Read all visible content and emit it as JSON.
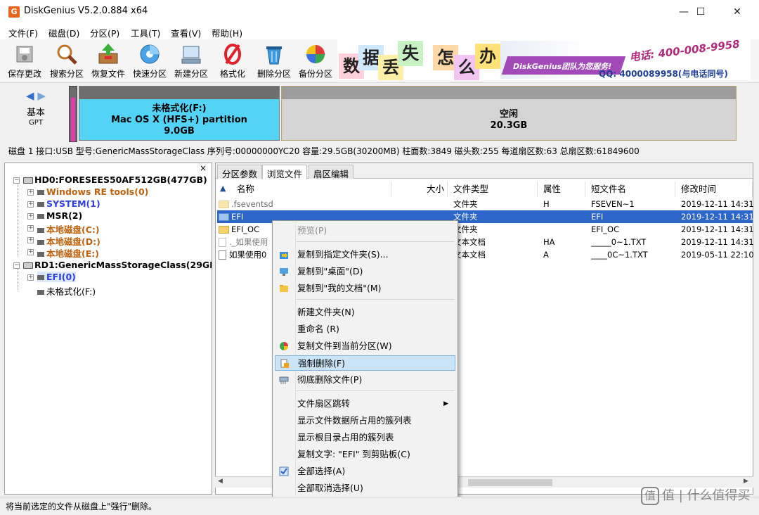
{
  "window": {
    "title": "DiskGenius V5.2.0.884 x64",
    "min_glyph": "—",
    "max_glyph": "☐",
    "close_glyph": "✕"
  },
  "menu": [
    "文件(F)",
    "磁盘(D)",
    "分区(P)",
    "工具(T)",
    "查看(V)",
    "帮助(H)"
  ],
  "toolbar": [
    {
      "label": "保存更改",
      "icon": "save-icon"
    },
    {
      "label": "搜索分区",
      "icon": "magnifier-icon"
    },
    {
      "label": "恢复文件",
      "icon": "recover-icon"
    },
    {
      "label": "快速分区",
      "icon": "quick-partition-icon"
    },
    {
      "label": "新建分区",
      "icon": "new-partition-icon"
    },
    {
      "label": "格式化",
      "icon": "format-icon"
    },
    {
      "label": "删除分区",
      "icon": "trash-icon"
    },
    {
      "label": "备份分区",
      "icon": "backup-icon"
    }
  ],
  "banner": {
    "tiles": [
      "数",
      "据",
      "丢",
      "失",
      "怎",
      "么",
      "办"
    ],
    "slogan": "DiskGenius团队为您服务!",
    "phone": "电话: 400-008-9958",
    "qq": "QQ: 4000089958(与电话同号)"
  },
  "diskmap": {
    "basic_label": "基本",
    "gpt_label": "GPT",
    "partition_f": {
      "name": "未格式化(F:)",
      "fs": "Mac OS X (HFS+) partition",
      "size": "9.0GB"
    },
    "free": {
      "name": "空闲",
      "size": "20.3GB"
    }
  },
  "disk_info": "磁盘 1 接口:USB  型号:GenericMassStorageClass  序列号:00000000YC20  容量:29.5GB(30200MB)  柱面数:3849  磁头数:255  每道扇区数:63  总扇区数:61849600",
  "tree": {
    "close_glyph": "×",
    "hd0": "HD0:FORESEES50AF512GB(477GB)",
    "hd0_children": [
      "Windows RE tools(0)",
      "SYSTEM(1)",
      "MSR(2)",
      "本地磁盘(C:)",
      "本地磁盘(D:)",
      "本地磁盘(E:)"
    ],
    "rd1": "RD1:GenericMassStorageClass(29GB",
    "rd1_children": [
      "EFI(0)",
      "未格式化(F:)"
    ]
  },
  "tabs": [
    "分区参数",
    "浏览文件",
    "扇区编辑"
  ],
  "columns": [
    "名称",
    "大小",
    "文件类型",
    "属性",
    "短文件名",
    "修改时间"
  ],
  "files": [
    {
      "name": ".fseventsd",
      "size": "",
      "type": "文件夹",
      "attr": "H",
      "short": "FSEVEN~1",
      "mtime": "2019-12-11 14:31"
    },
    {
      "name": "EFI",
      "size": "",
      "type": "文件夹",
      "attr": "",
      "short": "EFI",
      "mtime": "2019-12-11 14:31"
    },
    {
      "name": "EFI_OC",
      "size": "",
      "type": "文件夹",
      "attr": "",
      "short": "EFI_OC",
      "mtime": "2019-12-11 14:31"
    },
    {
      "name": "._如果使用",
      "size": "",
      "type": "文本文档",
      "attr": "HA",
      "short": "_____0~1.TXT",
      "mtime": "2019-12-11 14:31"
    },
    {
      "name": "如果使用0",
      "size": "",
      "type": "文本文档",
      "attr": "A",
      "short": "____0C~1.TXT",
      "mtime": "2019-05-11 22:10"
    }
  ],
  "context_menu": {
    "preview": "预览(P)",
    "copy_to_folder": "复制到指定文件夹(S)...",
    "copy_to_desktop": "复制到\"桌面\"(D)",
    "copy_to_docs": "复制到\"我的文档\"(M)",
    "new_folder": "新建文件夹(N)",
    "rename": "重命名 (R)",
    "copy_to_current": "复制文件到当前分区(W)",
    "force_delete": "强制删除(F)",
    "wipe_delete": "彻底删除文件(P)",
    "sector_jump": "文件扇区跳转",
    "show_file_clusters": "显示文件数据所占用的簇列表",
    "show_root_clusters": "显示根目录占用的簇列表",
    "copy_text": "复制文字: \"EFI\" 到剪贴板(C)",
    "select_all": "全部选择(A)",
    "deselect_all": "全部取消选择(U)"
  },
  "status": "将当前选定的文件从磁盘上\"强行\"删除。",
  "watermark": "值 | 什么值得买"
}
